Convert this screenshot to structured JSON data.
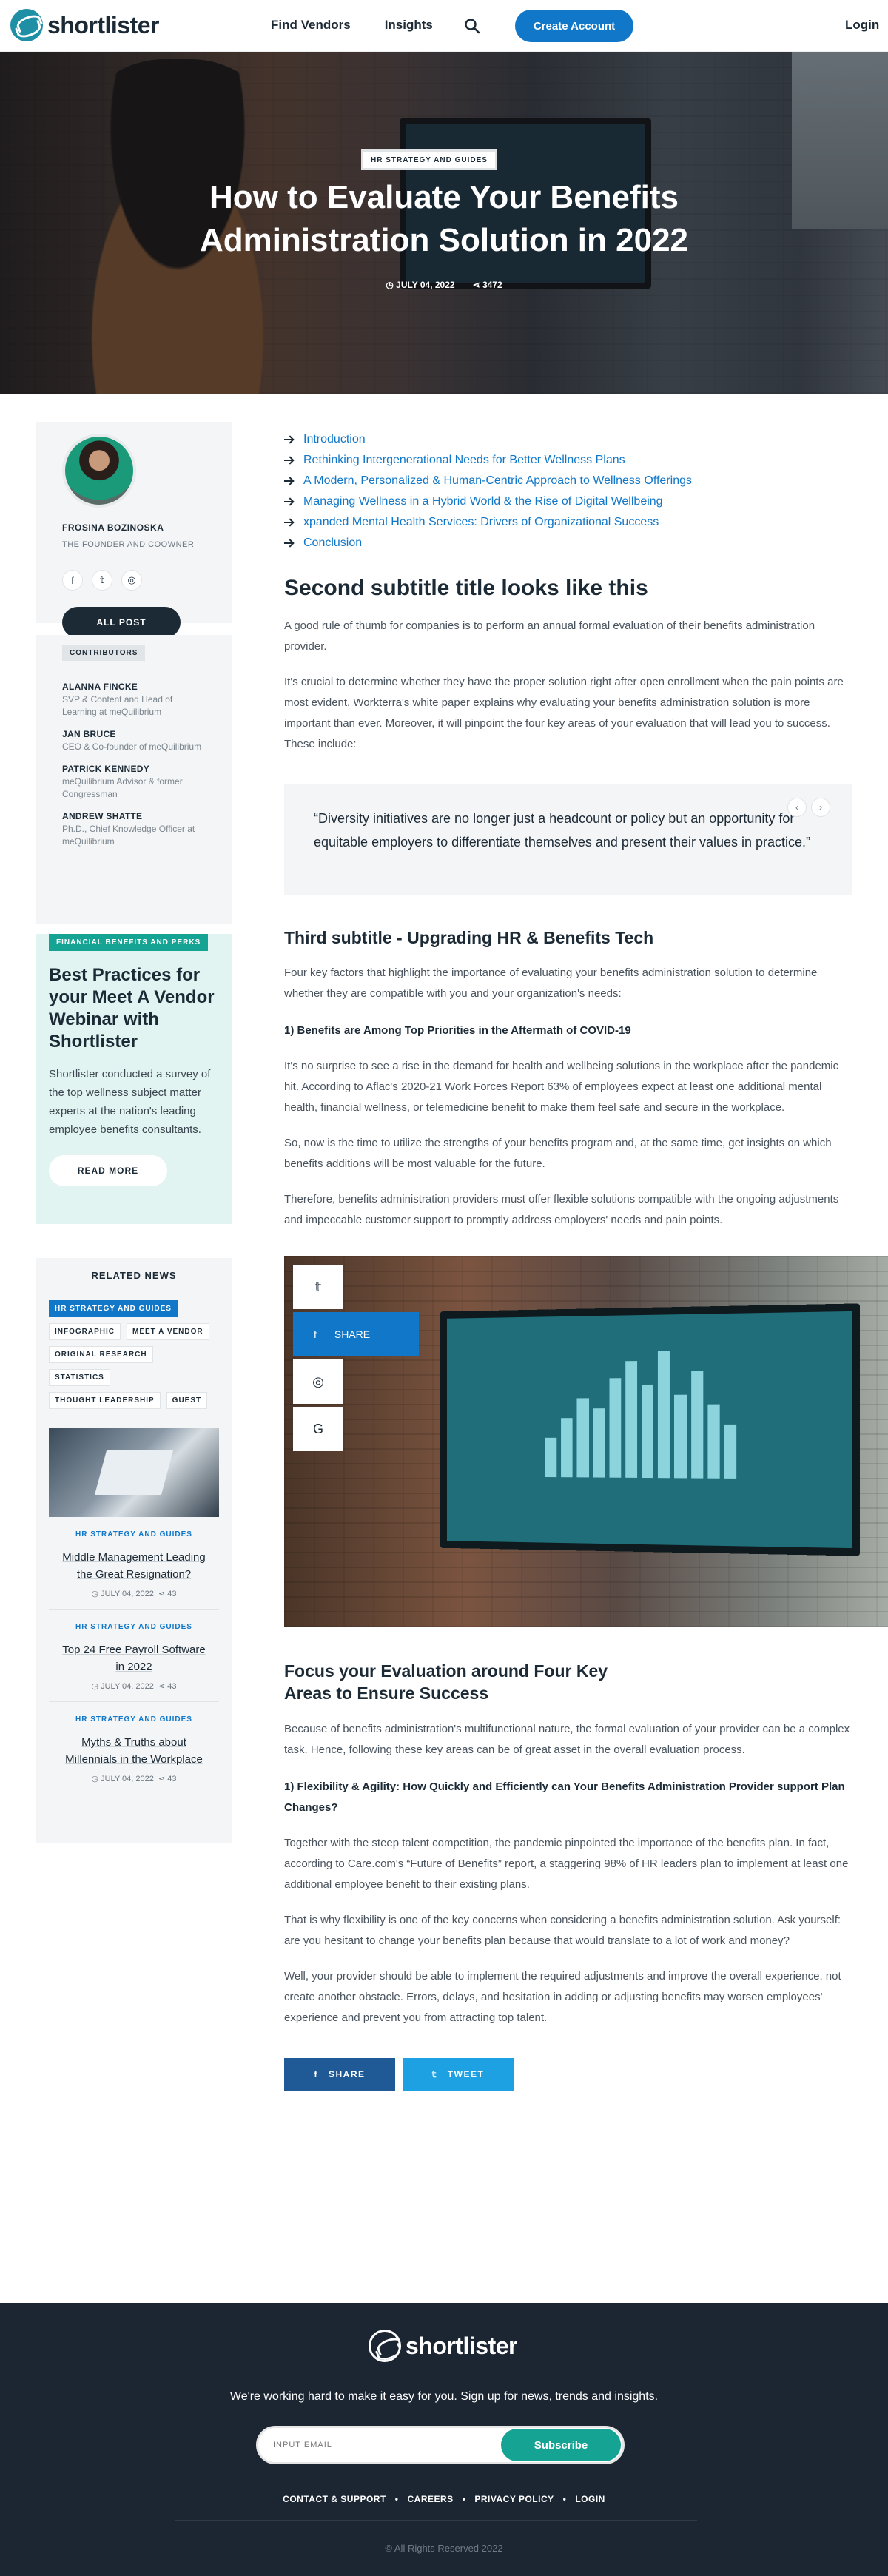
{
  "header": {
    "logo": "shortlister",
    "nav": [
      "Find Vendors",
      "Insights"
    ],
    "create_account": "Create Account",
    "login": "Login"
  },
  "hero": {
    "tag": "HR STRATEGY AND GUIDES",
    "title": "How to Evaluate Your Benefits Administration Solution in 2022",
    "date": "JULY 04, 2022",
    "shares": "3472"
  },
  "author": {
    "name": "FROSINA BOZINOSKA",
    "role": "THE FOUNDER AND COOWNER",
    "all_post": "ALL POST"
  },
  "contributors": {
    "label": "CONTRIBUTORS",
    "items": [
      {
        "name": "ALANNA FINCKE",
        "role": "SVP & Content and Head of Learning at meQuilibrium"
      },
      {
        "name": "JAN BRUCE",
        "role": "CEO & Co-founder of meQuilibrium"
      },
      {
        "name": "PATRICK KENNEDY",
        "role": "meQuilibrium Advisor & former Congressman"
      },
      {
        "name": "ANDREW SHATTE",
        "role": "Ph.D., Chief Knowledge Officer at meQuilibrium"
      }
    ]
  },
  "promo": {
    "tag": "FINANCIAL BENEFITS AND PERKS",
    "title": "Best Practices for your Meet A Vendor Webinar with Shortlister",
    "text": "Shortlister conducted a survey of the top wellness subject matter experts at the nation's leading employee benefits consultants.",
    "button": "READ MORE"
  },
  "related": {
    "title": "RELATED NEWS",
    "tags": [
      "HR STRATEGY AND GUIDES",
      "INFOGRAPHIC",
      "MEET A VENDOR",
      "ORIGINAL RESEARCH",
      "STATISTICS",
      "THOUGHT LEADERSHIP",
      "GUEST"
    ],
    "posts": [
      {
        "category": "HR STRATEGY AND GUIDES",
        "title": "Middle Management Leading the Great Resignation?",
        "date": "JULY 04, 2022",
        "shares": "43"
      },
      {
        "category": "HR STRATEGY AND GUIDES",
        "title": "Top 24 Free Payroll Software in 2022",
        "date": "JULY 04, 2022",
        "shares": "43"
      },
      {
        "category": "HR STRATEGY AND GUIDES",
        "title": "Myths & Truths about Millennials in the Workplace",
        "date": "JULY 04, 2022",
        "shares": "43"
      }
    ]
  },
  "toc": [
    "Introduction",
    "Rethinking Intergenerational Needs for Better Wellness Plans",
    "A Modern, Personalized & Human-Centric Approach to Wellness Offerings",
    "Managing Wellness in a Hybrid World & the Rise of Digital Wellbeing",
    "xpanded Mental Health Services: Drivers of Organizational Success",
    "Conclusion"
  ],
  "article": {
    "h2": "Second subtitle title looks like this",
    "p1": "A good rule of thumb for companies is to perform an annual formal evaluation of their benefits administration provider.",
    "p2": "It's crucial to determine whether they have the proper solution right after open enrollment when the pain points are most evident. Workterra's white paper explains why evaluating your benefits administration solution is more important than ever. Moreover, it will pinpoint the four key areas of your evaluation that will lead you to success. These include:",
    "quote": "“Diversity initiatives are no longer just a headcount or policy but an opportunity for equitable employers to differentiate themselves and present their values in practice.”",
    "h3": "Third subtitle - Upgrading HR & Benefits Tech",
    "p3": "Four key factors that highlight the importance of evaluating your benefits administration solution to determine whether they are compatible with you and your organization's needs:",
    "h4a": "1) Benefits are Among Top Priorities in the Aftermath of COVID-19",
    "p4": "It's no surprise to see a rise in the demand for health and wellbeing solutions in the workplace after the pandemic hit. According to Aflac's 2020-21 Work Forces Report 63% of employees expect at least one additional mental health, financial wellness, or telemedicine benefit to make them feel safe and secure in the workplace.",
    "p5": "So, now is the time to utilize the strengths of your benefits program and, at the same time, get insights on which benefits additions will be most valuable for the future.",
    "p6": "Therefore, benefits administration providers must offer flexible solutions compatible with the ongoing adjustments and impeccable customer support to promptly address employers' needs and pain points.",
    "share_label": "SHARE",
    "h3b": "Focus your Evaluation around Four Key Areas to Ensure Success",
    "p7": "Because of benefits administration's multifunctional nature, the formal evaluation of your provider can be a complex task. Hence, following these key areas can be of great asset in the overall evaluation process.",
    "h4b": "1) Flexibility & Agility: How Quickly and Efficiently can Your Benefits Administration Provider support Plan Changes?",
    "p8": "Together with the steep talent competition, the pandemic pinpointed the importance of the benefits plan. In fact, according to Care.com's “Future of Benefits” report, a staggering 98% of HR leaders plan to implement at least one additional employee benefit to their existing plans.",
    "p9": "That is why flexibility is one of the key concerns when considering a benefits administration solution. Ask yourself: are you hesitant to change your benefits plan because that would translate to a lot of work and money?",
    "p10": "Well, your provider should be able to implement the required adjustments and improve the overall experience, not create another obstacle. Errors, delays, and hesitation in adding or adjusting benefits may worsen employees' experience and prevent you from attracting top talent.",
    "share_btn": "SHARE",
    "tweet_btn": "TWEET"
  },
  "footer": {
    "logo": "shortlister",
    "tagline": "We're working hard to make it easy for you. Sign up for news, trends and insights.",
    "email_placeholder": "INPUT EMAIL",
    "subscribe": "Subscribe",
    "links": [
      "CONTACT & SUPPORT",
      "CAREERS",
      "PRIVACY POLICY",
      "LOGIN"
    ],
    "copyright": "© All Rights Reserved 2022"
  },
  "colors": {
    "accent": "#1177c8",
    "teal": "#15a394",
    "dark": "#1c2633"
  }
}
